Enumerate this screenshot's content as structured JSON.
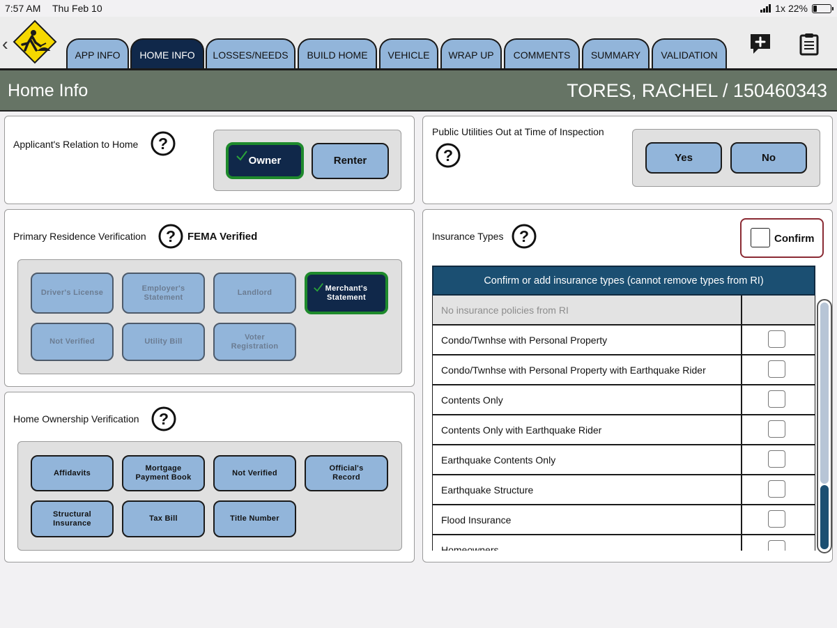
{
  "status_bar": {
    "time": "7:57 AM",
    "date": "Thu Feb 10",
    "network": "1x",
    "battery": "22%",
    "battery_level": 0.22
  },
  "header": {
    "back_icon": "chevron-left-icon",
    "logo_icon": "construction-worker-sign-icon",
    "tabs": [
      {
        "label": "APP INFO"
      },
      {
        "label": "HOME INFO",
        "active": true
      },
      {
        "label": "LOSSES/NEEDS"
      },
      {
        "label": "BUILD HOME"
      },
      {
        "label": "VEHICLE"
      },
      {
        "label": "WRAP UP"
      },
      {
        "label": "COMMENTS"
      },
      {
        "label": "SUMMARY"
      },
      {
        "label": "VALIDATION"
      }
    ],
    "actions": [
      "add-comment-icon",
      "clipboard-icon"
    ]
  },
  "title_bar": {
    "page_title": "Home Info",
    "applicant": "TORES, RACHEL / 150460343"
  },
  "colors": {
    "tab": "#92b5da",
    "tab_active": "#10284a",
    "title_bar": "#667465",
    "selected_border": "#1e8a2c",
    "table_header": "#1b4f72",
    "confirm_border": "#8a2a33"
  },
  "relation": {
    "label": "Applicant's Relation to Home",
    "options": [
      {
        "label": "Owner",
        "selected": true
      },
      {
        "label": "Renter",
        "selected": false
      }
    ]
  },
  "utilities": {
    "label": "Public Utilities Out at Time of Inspection",
    "options": [
      {
        "label": "Yes"
      },
      {
        "label": "No"
      }
    ]
  },
  "residence": {
    "label": "Primary Residence Verification",
    "status": "FEMA Verified",
    "options": [
      {
        "label": "Driver's License",
        "state": "disabled"
      },
      {
        "label": "Employer's Statement",
        "state": "disabled"
      },
      {
        "label": "Landlord",
        "state": "disabled"
      },
      {
        "label": "Merchant's Statement",
        "state": "selected"
      },
      {
        "label": "Not Verified",
        "state": "disabled"
      },
      {
        "label": "Utility Bill",
        "state": "disabled"
      },
      {
        "label": "Voter Registration",
        "state": "disabled"
      }
    ]
  },
  "ownership": {
    "label": "Home Ownership Verification",
    "options": [
      {
        "label": "Affidavits"
      },
      {
        "label": "Mortgage Payment Book"
      },
      {
        "label": "Not Verified"
      },
      {
        "label": "Official's Record"
      },
      {
        "label": "Structural Insurance"
      },
      {
        "label": "Tax Bill"
      },
      {
        "label": "Title Number"
      }
    ]
  },
  "insurance": {
    "label": "Insurance Types",
    "confirm_label": "Confirm",
    "table_header": "Confirm or add insurance types (cannot remove types from RI)",
    "empty_row": "No insurance policies from RI",
    "rows": [
      {
        "name": "Condo/Twnhse with Personal Property",
        "checked": false
      },
      {
        "name": "Condo/Twnhse with Personal Property with Earthquake Rider",
        "checked": false
      },
      {
        "name": "Contents Only",
        "checked": false
      },
      {
        "name": "Contents Only with Earthquake Rider",
        "checked": false
      },
      {
        "name": "Earthquake Contents Only",
        "checked": false
      },
      {
        "name": "Earthquake Structure",
        "checked": false
      },
      {
        "name": "Flood Insurance",
        "checked": false
      },
      {
        "name": "Homeowners",
        "checked": false
      }
    ]
  }
}
